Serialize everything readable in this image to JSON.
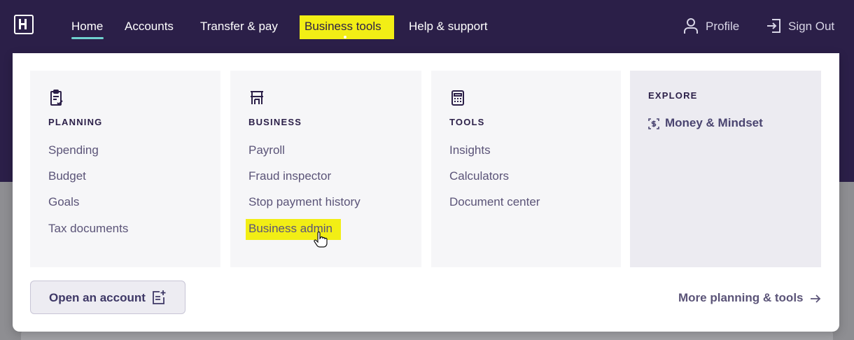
{
  "nav": {
    "home": "Home",
    "accounts": "Accounts",
    "transfer": "Transfer & pay",
    "business_tools": "Business tools",
    "help": "Help & support",
    "profile": "Profile",
    "sign_out": "Sign Out"
  },
  "menu": {
    "planning": {
      "heading": "PLANNING",
      "icon": "clipboard-check-icon",
      "links": [
        "Spending",
        "Budget",
        "Goals",
        "Tax documents"
      ]
    },
    "business": {
      "heading": "BUSINESS",
      "icon": "storefront-icon",
      "links": [
        "Payroll",
        "Fraud inspector",
        "Stop payment history",
        "Business admin"
      ]
    },
    "tools": {
      "heading": "TOOLS",
      "icon": "calculator-icon",
      "links": [
        "Insights",
        "Calculators",
        "Document center"
      ]
    },
    "explore": {
      "heading": "EXPLORE",
      "links": [
        "Money & Mindset"
      ]
    },
    "open_account": "Open an account",
    "more": "More planning & tools"
  },
  "colors": {
    "nav_bg": "#2b1f48",
    "highlight": "#f2ee15",
    "accent_underline": "#6fd1cf"
  }
}
